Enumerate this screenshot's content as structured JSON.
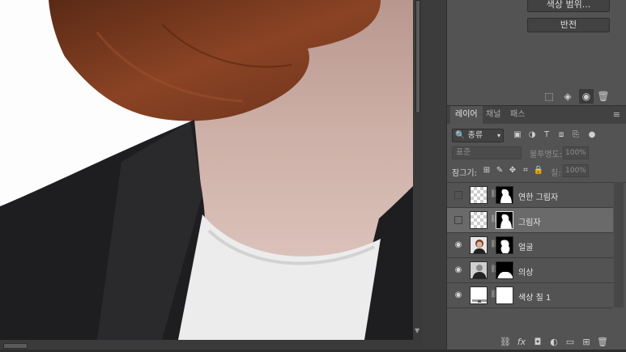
{
  "properties": {
    "color_range_label": "색상 범위...",
    "invert_label": "반전"
  },
  "layers_panel": {
    "tabs": [
      {
        "label": "레이어",
        "active": true
      },
      {
        "label": "채널",
        "active": false
      },
      {
        "label": "패스",
        "active": false
      }
    ],
    "filter_kind": "종류",
    "blend_mode": "표준",
    "opacity_label": "불투명도:",
    "opacity_value": "100%",
    "lock_label": "잠그기:",
    "fill_label": "칠:",
    "fill_value": "100%",
    "layers": [
      {
        "name": "연한 그림자",
        "visible": false,
        "selected": false
      },
      {
        "name": "그림자",
        "visible": false,
        "selected": true
      },
      {
        "name": "얼굴",
        "visible": true,
        "selected": false
      },
      {
        "name": "의상",
        "visible": true,
        "selected": false
      },
      {
        "name": "색상 칠 1",
        "visible": true,
        "selected": false
      }
    ]
  },
  "colors": {
    "panel_bg": "#535353",
    "selected_row": "#6a6a6a",
    "jacket": "#1f1f21",
    "hair": "#7a3a1e",
    "skin": "#c9a9a0",
    "shirt": "#ececec"
  }
}
